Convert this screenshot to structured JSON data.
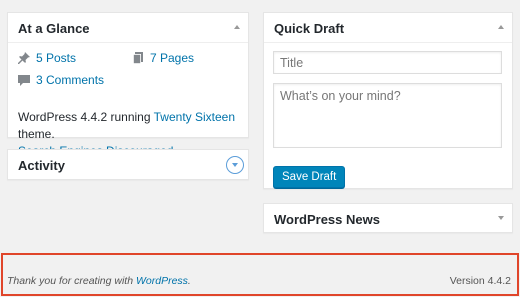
{
  "at_a_glance": {
    "title": "At a Glance",
    "posts": "5 Posts",
    "pages": "7 Pages",
    "comments": "3 Comments",
    "status_prefix": "WordPress 4.4.2 running ",
    "theme_link": "Twenty Sixteen",
    "status_suffix": " theme.",
    "search_engines": "Search Engines Discouraged"
  },
  "activity": {
    "title": "Activity"
  },
  "quick_draft": {
    "title": "Quick Draft",
    "title_placeholder": "Title",
    "content_placeholder": "What’s on your mind?",
    "save_label": "Save Draft"
  },
  "wordpress_news": {
    "title": "WordPress News"
  },
  "footer": {
    "thanks_prefix": "Thank you for creating with ",
    "thanks_link": "WordPress",
    "thanks_suffix": ".",
    "version": "Version 4.4.2"
  },
  "colors": {
    "link": "#0073aa",
    "primary_button": "#0085ba",
    "highlight_border": "#e0452a",
    "toggle_active": "#5b9dd9"
  }
}
